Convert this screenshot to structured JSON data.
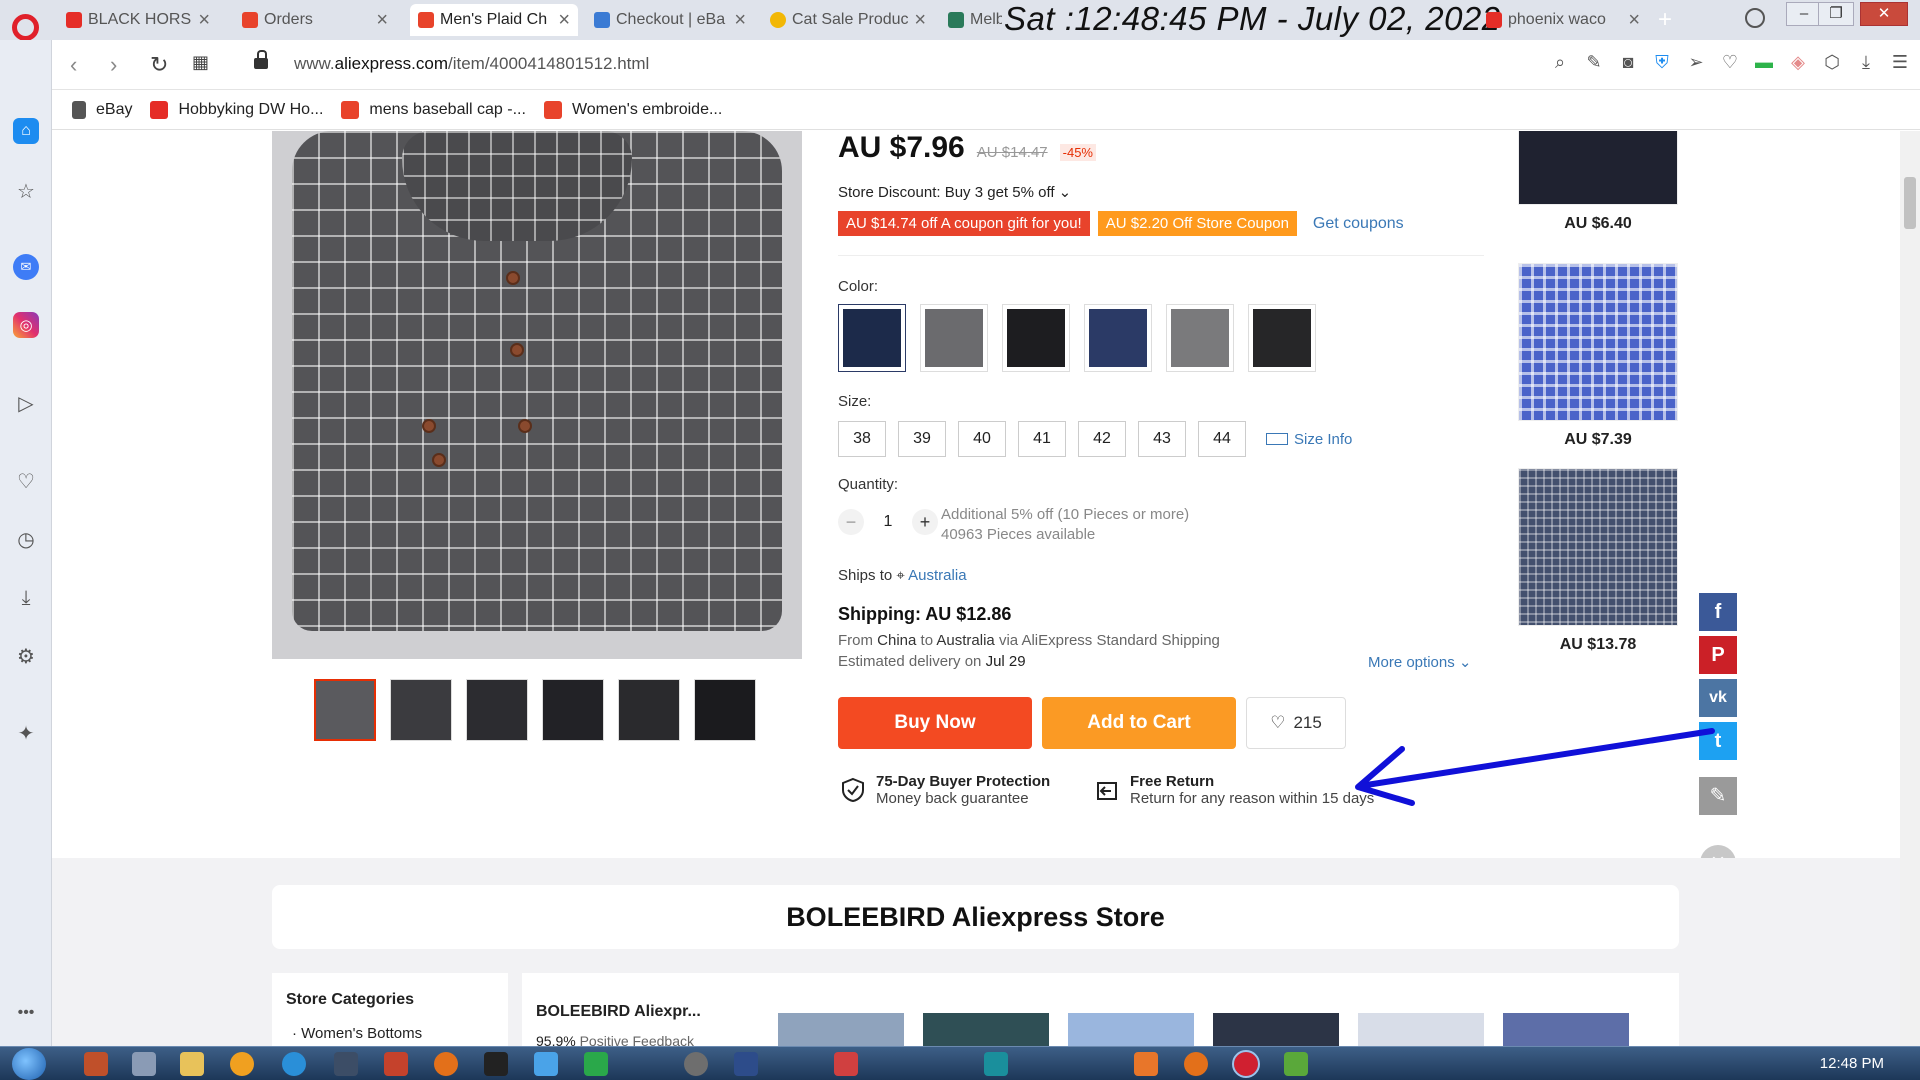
{
  "browser": {
    "tabs": [
      {
        "label": "BLACK HORSE",
        "color": "#e52d27",
        "active": false
      },
      {
        "label": "Orders",
        "color": "#e8432b",
        "active": false
      },
      {
        "label": "Men's Plaid Ch",
        "color": "#e8432b",
        "active": true
      },
      {
        "label": "Checkout | eBa",
        "color": "#3b7bd4",
        "active": false
      },
      {
        "label": "Cat Sale Produc",
        "color": "#f2b705",
        "active": false
      },
      {
        "label": "Melb",
        "color": "#2a7a5a",
        "active": false
      },
      {
        "label": "phoenix waco",
        "color": "#e52d27",
        "active": false
      }
    ],
    "clock_overlay": "Sat :12:48:45 PM - July 02, 2022",
    "url_prefix": "www.",
    "url_domain": "aliexpress.com",
    "url_path": "/item/4000414801512.html",
    "bookmarks": [
      {
        "label": "eBay",
        "color": "#555555"
      },
      {
        "label": "Hobbyking DW Ho...",
        "color": "#e52d27"
      },
      {
        "label": "mens baseball cap -...",
        "color": "#e8432b"
      },
      {
        "label": "Women's embroide...",
        "color": "#e8432b"
      }
    ]
  },
  "product": {
    "price": "AU $7.96",
    "old_price": "AU $14.47",
    "discount": "-45%",
    "store_discount": "Store Discount: Buy 3 get 5% off ⌄",
    "coupon_1": "AU $14.74 off A coupon gift for you!",
    "coupon_2": "AU $2.20 Off Store Coupon",
    "get_coupons": "Get coupons",
    "color_label": "Color:",
    "colors": [
      "#1c2a4a",
      "#6b6b6e",
      "#1d1d20",
      "#2b3a66",
      "#7a7a7c",
      "#262628"
    ],
    "size_label": "Size:",
    "sizes": [
      "38",
      "39",
      "40",
      "41",
      "42",
      "43",
      "44"
    ],
    "size_info": "Size Info",
    "quantity_label": "Quantity:",
    "quantity": "1",
    "qty_note_1": "Additional 5% off (10 Pieces or more)",
    "qty_note_2": "40963 Pieces available",
    "ships_to_label": "Ships to",
    "ships_to": "Australia",
    "shipping": "Shipping: AU $12.86",
    "ship_from_prefix": "From",
    "ship_from_origin": "China",
    "ship_from_to": "to",
    "ship_from_dest": "Australia",
    "ship_from_suffix": "via AliExpress Standard Shipping",
    "ship_est_prefix": "Estimated delivery on",
    "ship_est_date": "Jul 29",
    "more_options": "More options ⌄",
    "buy_now": "Buy Now",
    "add_to_cart": "Add to Cart",
    "wishlist_count": "215",
    "guarantee_1_title": "75-Day Buyer Protection",
    "guarantee_1_sub": "Money back guarantee",
    "guarantee_2_title": "Free Return",
    "guarantee_2_sub": "Return for any reason within 15 days"
  },
  "recommended": [
    {
      "price": "AU $6.40",
      "color": "#1f2230"
    },
    {
      "price": "AU $7.39",
      "color": "#4a63c9"
    },
    {
      "price": "AU $13.78",
      "color": "#43506e"
    }
  ],
  "store": {
    "title": "BOLEEBIRD Aliexpress Store",
    "categories_title": "Store Categories",
    "category_1": "Women's Bottoms",
    "name": "BOLEEBIRD Aliexpr...",
    "feedback_value": "95.9%",
    "feedback_label": "Positive Feedback"
  },
  "taskbar": {
    "time": "12:48 PM"
  },
  "colors": {
    "accent_red": "#f34a22",
    "accent_orange": "#fb9a24",
    "link_blue": "#3a78b6",
    "annotation_arrow": "#1010d8"
  }
}
